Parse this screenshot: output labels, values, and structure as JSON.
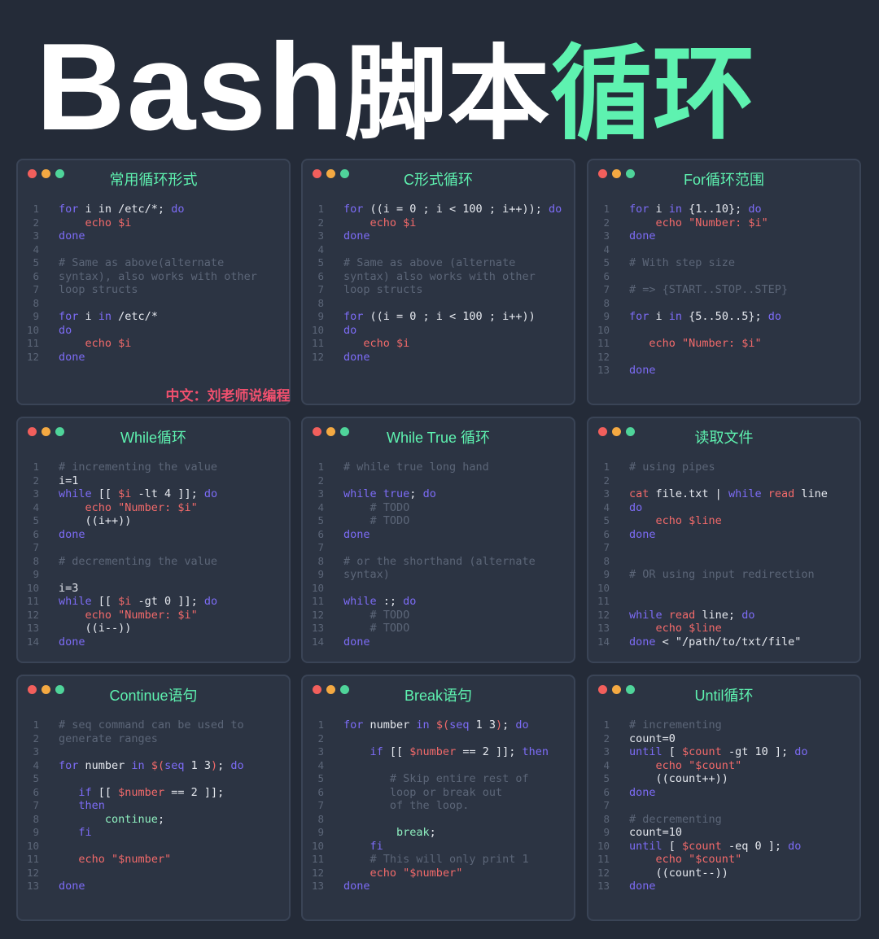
{
  "header": {
    "title_latin": "Bash",
    "title_cn_white": "脚本",
    "title_cn_green": "循环"
  },
  "watermark": "中文：刘老师说编程",
  "colors": {
    "background": "#242b38",
    "panel": "#2c3443",
    "title_green": "#5ef2b0",
    "keyword": "#7d6cf7",
    "variable": "#f26a6a",
    "comment": "#5c6678"
  },
  "panels": [
    {
      "title": "常用循环形式",
      "lines": [
        [
          [
            "kw",
            "for"
          ],
          [
            "t",
            " i in /etc/*; "
          ],
          [
            "kw",
            "do"
          ]
        ],
        [
          [
            "t",
            "    "
          ],
          [
            "cmd",
            "echo"
          ],
          [
            "t",
            " "
          ],
          [
            "var",
            "$i"
          ]
        ],
        [
          [
            "kw",
            "done"
          ]
        ],
        [],
        [
          [
            "cmt",
            "# Same as above(alternate"
          ]
        ],
        [
          [
            "cmt",
            "syntax), also works with other"
          ]
        ],
        [
          [
            "cmt",
            "loop structs"
          ]
        ],
        [],
        [
          [
            "kw",
            "for"
          ],
          [
            "t",
            " i "
          ],
          [
            "kw",
            "in"
          ],
          [
            "t",
            " /etc/*"
          ]
        ],
        [
          [
            "kw",
            "do"
          ]
        ],
        [
          [
            "t",
            "    "
          ],
          [
            "cmd",
            "echo"
          ],
          [
            "t",
            " "
          ],
          [
            "var",
            "$i"
          ]
        ],
        [
          [
            "kw",
            "done"
          ]
        ]
      ]
    },
    {
      "title": "C形式循环",
      "lines": [
        [
          [
            "kw",
            "for"
          ],
          [
            "t",
            " ((i = 0 ; i < 100 ; i++)); "
          ],
          [
            "kw",
            "do"
          ]
        ],
        [
          [
            "t",
            "    "
          ],
          [
            "cmd",
            "echo"
          ],
          [
            "t",
            " "
          ],
          [
            "var",
            "$i"
          ]
        ],
        [
          [
            "kw",
            "done"
          ]
        ],
        [],
        [
          [
            "cmt",
            "# Same as above (alternate"
          ]
        ],
        [
          [
            "cmt",
            "syntax) also works with other"
          ]
        ],
        [
          [
            "cmt",
            "loop structs"
          ]
        ],
        [],
        [
          [
            "kw",
            "for"
          ],
          [
            "t",
            " ((i = 0 ; i < 100 ; i++))"
          ]
        ],
        [
          [
            "kw",
            "do"
          ]
        ],
        [
          [
            "t",
            "   "
          ],
          [
            "cmd",
            "echo"
          ],
          [
            "t",
            " "
          ],
          [
            "var",
            "$i"
          ]
        ],
        [
          [
            "kw",
            "done"
          ]
        ]
      ]
    },
    {
      "title": "For循环范围",
      "lines": [
        [
          [
            "kw",
            "for"
          ],
          [
            "t",
            " i "
          ],
          [
            "kw",
            "in"
          ],
          [
            "t",
            " {1..10}; "
          ],
          [
            "kw",
            "do"
          ]
        ],
        [
          [
            "t",
            "    "
          ],
          [
            "cmd",
            "echo"
          ],
          [
            "t",
            " "
          ],
          [
            "str",
            "\"Number: $i\""
          ]
        ],
        [
          [
            "kw",
            "done"
          ]
        ],
        [],
        [
          [
            "cmt",
            "# With step size"
          ]
        ],
        [],
        [
          [
            "cmt",
            "# => {START..STOP..STEP}"
          ]
        ],
        [],
        [
          [
            "kw",
            "for"
          ],
          [
            "t",
            " i "
          ],
          [
            "kw",
            "in"
          ],
          [
            "t",
            " {5..50..5}; "
          ],
          [
            "kw",
            "do"
          ]
        ],
        [],
        [
          [
            "t",
            "   "
          ],
          [
            "cmd",
            "echo"
          ],
          [
            "t",
            " "
          ],
          [
            "str",
            "\"Number: $i\""
          ]
        ],
        [],
        [
          [
            "kw",
            "done"
          ]
        ]
      ]
    },
    {
      "title": "While循环",
      "lines": [
        [
          [
            "cmt",
            "# incrementing the value"
          ]
        ],
        [
          [
            "t",
            "i=1"
          ]
        ],
        [
          [
            "kw",
            "while"
          ],
          [
            "t",
            " [[ "
          ],
          [
            "var",
            "$i"
          ],
          [
            "t",
            " -lt 4 ]]; "
          ],
          [
            "kw",
            "do"
          ]
        ],
        [
          [
            "t",
            "    "
          ],
          [
            "cmd",
            "echo"
          ],
          [
            "t",
            " "
          ],
          [
            "str",
            "\"Number: $i\""
          ]
        ],
        [
          [
            "t",
            "    ((i++))"
          ]
        ],
        [
          [
            "kw",
            "done"
          ]
        ],
        [],
        [
          [
            "cmt",
            "# decrementing the value"
          ]
        ],
        [],
        [
          [
            "t",
            "i=3"
          ]
        ],
        [
          [
            "kw",
            "while"
          ],
          [
            "t",
            " [[ "
          ],
          [
            "var",
            "$i"
          ],
          [
            "t",
            " -gt 0 ]]; "
          ],
          [
            "kw",
            "do"
          ]
        ],
        [
          [
            "t",
            "    "
          ],
          [
            "cmd",
            "echo"
          ],
          [
            "t",
            " "
          ],
          [
            "str",
            "\"Number: $i\""
          ]
        ],
        [
          [
            "t",
            "    ((i--))"
          ]
        ],
        [
          [
            "kw",
            "done"
          ]
        ]
      ]
    },
    {
      "title": "While True 循环",
      "lines": [
        [
          [
            "cmt",
            "# while true long hand"
          ]
        ],
        [],
        [
          [
            "kw",
            "while"
          ],
          [
            "t",
            " "
          ],
          [
            "kw",
            "true"
          ],
          [
            "t",
            "; "
          ],
          [
            "kw",
            "do"
          ]
        ],
        [
          [
            "t",
            "    "
          ],
          [
            "cmt",
            "# TODO"
          ]
        ],
        [
          [
            "t",
            "    "
          ],
          [
            "cmt",
            "# TODO"
          ]
        ],
        [
          [
            "kw",
            "done"
          ]
        ],
        [],
        [
          [
            "cmt",
            "# or the shorthand (alternate"
          ]
        ],
        [
          [
            "cmt",
            "syntax)"
          ]
        ],
        [],
        [
          [
            "kw",
            "while"
          ],
          [
            "t",
            " :; "
          ],
          [
            "kw",
            "do"
          ]
        ],
        [
          [
            "t",
            "    "
          ],
          [
            "cmt",
            "# TODO"
          ]
        ],
        [
          [
            "t",
            "    "
          ],
          [
            "cmt",
            "# TODO"
          ]
        ],
        [
          [
            "kw",
            "done"
          ]
        ]
      ]
    },
    {
      "title": "读取文件",
      "lines": [
        [
          [
            "cmt",
            "# using pipes"
          ]
        ],
        [],
        [
          [
            "cmd",
            "cat"
          ],
          [
            "t",
            " file.txt | "
          ],
          [
            "kw",
            "while"
          ],
          [
            "t",
            " "
          ],
          [
            "cmd",
            "read"
          ],
          [
            "t",
            " line"
          ]
        ],
        [
          [
            "kw",
            "do"
          ]
        ],
        [
          [
            "t",
            "    "
          ],
          [
            "cmd",
            "echo"
          ],
          [
            "t",
            " "
          ],
          [
            "var",
            "$line"
          ]
        ],
        [
          [
            "kw",
            "done"
          ]
        ],
        [],
        [],
        [
          [
            "cmt",
            "# OR using input redirection"
          ]
        ],
        [],
        [],
        [
          [
            "kw",
            "while"
          ],
          [
            "t",
            " "
          ],
          [
            "cmd",
            "read"
          ],
          [
            "t",
            " line; "
          ],
          [
            "kw",
            "do"
          ]
        ],
        [
          [
            "t",
            "    "
          ],
          [
            "cmd",
            "echo"
          ],
          [
            "t",
            " "
          ],
          [
            "var",
            "$line"
          ]
        ],
        [
          [
            "kw",
            "done"
          ],
          [
            "t",
            " < \"/path/to/txt/file\""
          ]
        ]
      ]
    },
    {
      "title": "Continue语句",
      "lines": [
        [
          [
            "cmt",
            "# seq command can be used to"
          ]
        ],
        [
          [
            "cmt",
            "generate ranges"
          ]
        ],
        [],
        [
          [
            "kw",
            "for"
          ],
          [
            "t",
            " number "
          ],
          [
            "kw",
            "in"
          ],
          [
            "t",
            " "
          ],
          [
            "var",
            "$("
          ],
          [
            "kw",
            "seq"
          ],
          [
            "t",
            " 1 3"
          ],
          [
            "var",
            ")"
          ],
          [
            "t",
            "; "
          ],
          [
            "kw",
            "do"
          ]
        ],
        [],
        [
          [
            "t",
            "   "
          ],
          [
            "kw",
            "if"
          ],
          [
            "t",
            " [[ "
          ],
          [
            "var",
            "$number"
          ],
          [
            "t",
            " == 2 ]];"
          ]
        ],
        [
          [
            "t",
            "   "
          ],
          [
            "kw",
            "then"
          ]
        ],
        [
          [
            "t",
            "       "
          ],
          [
            "grn",
            "continue"
          ],
          [
            "t",
            ";"
          ]
        ],
        [
          [
            "t",
            "   "
          ],
          [
            "kw",
            "fi"
          ]
        ],
        [],
        [
          [
            "t",
            "   "
          ],
          [
            "cmd",
            "echo"
          ],
          [
            "t",
            " "
          ],
          [
            "str",
            "\"$number\""
          ]
        ],
        [],
        [
          [
            "kw",
            "done"
          ]
        ]
      ]
    },
    {
      "title": "Break语句",
      "lines": [
        [
          [
            "kw",
            "for"
          ],
          [
            "t",
            " number "
          ],
          [
            "kw",
            "in"
          ],
          [
            "t",
            " "
          ],
          [
            "var",
            "$("
          ],
          [
            "kw",
            "seq"
          ],
          [
            "t",
            " 1 3"
          ],
          [
            "var",
            ")"
          ],
          [
            "t",
            "; "
          ],
          [
            "kw",
            "do"
          ]
        ],
        [],
        [
          [
            "t",
            "    "
          ],
          [
            "kw",
            "if"
          ],
          [
            "t",
            " [[ "
          ],
          [
            "var",
            "$number"
          ],
          [
            "t",
            " == 2 ]]; "
          ],
          [
            "kw",
            "then"
          ]
        ],
        [],
        [
          [
            "t",
            "       "
          ],
          [
            "cmt",
            "# Skip entire rest of"
          ]
        ],
        [
          [
            "t",
            "       "
          ],
          [
            "cmt",
            "loop or break out"
          ]
        ],
        [
          [
            "t",
            "       "
          ],
          [
            "cmt",
            "of the loop."
          ]
        ],
        [],
        [
          [
            "t",
            "        "
          ],
          [
            "grn",
            "break"
          ],
          [
            "t",
            ";"
          ]
        ],
        [
          [
            "t",
            "    "
          ],
          [
            "kw",
            "fi"
          ]
        ],
        [
          [
            "t",
            "    "
          ],
          [
            "cmt",
            "# This will only print 1"
          ]
        ],
        [
          [
            "t",
            "    "
          ],
          [
            "cmd",
            "echo"
          ],
          [
            "t",
            " "
          ],
          [
            "str",
            "\"$number\""
          ]
        ],
        [
          [
            "kw",
            "done"
          ]
        ]
      ]
    },
    {
      "title": "Until循环",
      "lines": [
        [
          [
            "cmt",
            "# incrementing"
          ]
        ],
        [
          [
            "t",
            "count=0"
          ]
        ],
        [
          [
            "kw",
            "until"
          ],
          [
            "t",
            " [ "
          ],
          [
            "var",
            "$count"
          ],
          [
            "t",
            " -gt 10 ]; "
          ],
          [
            "kw",
            "do"
          ]
        ],
        [
          [
            "t",
            "    "
          ],
          [
            "cmd",
            "echo"
          ],
          [
            "t",
            " "
          ],
          [
            "str",
            "\"$count\""
          ]
        ],
        [
          [
            "t",
            "    ((count++))"
          ]
        ],
        [
          [
            "kw",
            "done"
          ]
        ],
        [],
        [
          [
            "cmt",
            "# decrementing"
          ]
        ],
        [
          [
            "t",
            "count=10"
          ]
        ],
        [
          [
            "kw",
            "until"
          ],
          [
            "t",
            " [ "
          ],
          [
            "var",
            "$count"
          ],
          [
            "t",
            " -eq 0 ]; "
          ],
          [
            "kw",
            "do"
          ]
        ],
        [
          [
            "t",
            "    "
          ],
          [
            "cmd",
            "echo"
          ],
          [
            "t",
            " "
          ],
          [
            "str",
            "\"$count\""
          ]
        ],
        [
          [
            "t",
            "    ((count--))"
          ]
        ],
        [
          [
            "kw",
            "done"
          ]
        ]
      ]
    }
  ]
}
